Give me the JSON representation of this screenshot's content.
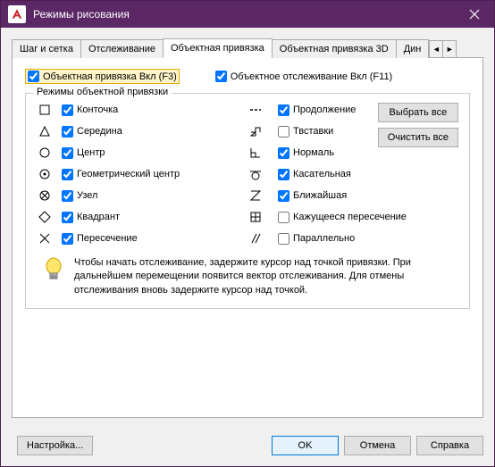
{
  "titlebar": {
    "title": "Режимы рисования"
  },
  "tabs": {
    "items": [
      "Шаг и сетка",
      "Отслеживание",
      "Объектная привязка",
      "Объектная привязка 3D",
      "Дин"
    ],
    "active": 2
  },
  "top": {
    "osnap": {
      "label": "Объектная привязка Вкл (F3)",
      "checked": true
    },
    "otrack": {
      "label": "Объектное отслеживание Вкл (F11)",
      "checked": true
    }
  },
  "group": {
    "legend": "Режимы объектной привязки",
    "left": [
      {
        "icon": "endpoint",
        "label": "Конточка",
        "c": true
      },
      {
        "icon": "midpoint",
        "label": "Середина",
        "c": true
      },
      {
        "icon": "center",
        "label": "Центр",
        "c": true
      },
      {
        "icon": "geocenter",
        "label": "Геометрический центр",
        "c": true
      },
      {
        "icon": "node",
        "label": "Узел",
        "c": true
      },
      {
        "icon": "quadrant",
        "label": "Квадрант",
        "c": true
      },
      {
        "icon": "intersection",
        "label": "Пересечение",
        "c": true
      }
    ],
    "right": [
      {
        "icon": "extension",
        "label": "Продолжение",
        "c": true
      },
      {
        "icon": "insertion",
        "label": "Твставки",
        "c": false
      },
      {
        "icon": "perp",
        "label": "Нормаль",
        "c": true
      },
      {
        "icon": "tangent",
        "label": "Касательная",
        "c": true
      },
      {
        "icon": "nearest",
        "label": "Ближайшая",
        "c": true
      },
      {
        "icon": "appint",
        "label": "Кажущееся пересечение",
        "c": false
      },
      {
        "icon": "parallel",
        "label": "Параллельно",
        "c": false
      }
    ],
    "btn_all": "Выбрать все",
    "btn_none": "Очистить все",
    "tip": "Чтобы начать отслеживание, задержите курсор над точкой привязки. При дальнейшем перемещении появится вектор отслеживания. Для отмены отслеживания вновь задержите курсор над точкой."
  },
  "footer": {
    "options": "Настройка...",
    "ok": "OK",
    "cancel": "Отмена",
    "help": "Справка"
  }
}
